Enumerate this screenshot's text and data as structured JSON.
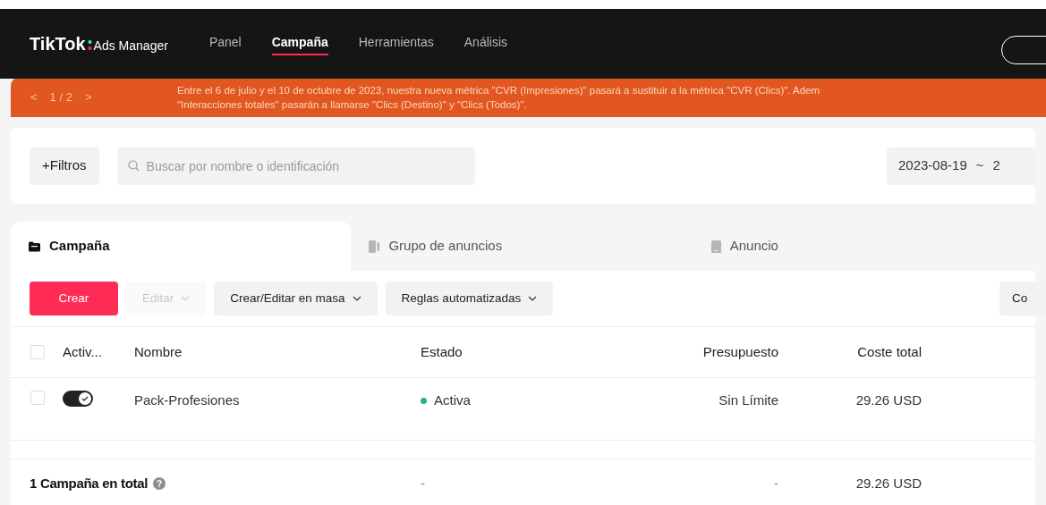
{
  "header": {
    "logo": "TikTok",
    "logo_sub": "Ads Manager",
    "nav": [
      {
        "label": "Panel",
        "selected": false
      },
      {
        "label": "Campaña",
        "selected": true
      },
      {
        "label": "Herramientas",
        "selected": false
      },
      {
        "label": "Análisis",
        "selected": false
      }
    ]
  },
  "banner": {
    "pager": "1 / 2",
    "prev": "<",
    "next": ">",
    "lines": [
      "Entre el 6 de julio y el 10 de octubre de 2023, nuestra nueva métrica \"CVR (Impresiones)\" pasará a sustituir a la métrica \"CVR (Clics)\". Adem",
      "\"Interacciones totales\" pasarán a llamarse \"Clics (Destino)\" y \"Clics (Todos)\"."
    ]
  },
  "filters": {
    "button": "+Filtros",
    "search": {
      "placeholder": "Buscar por nombre o identificación"
    },
    "date_from": "2023-08-19",
    "date_sep": "~",
    "date_to": "2"
  },
  "tabs": [
    {
      "label": "Campaña",
      "selected": true
    },
    {
      "label": "Grupo de anuncios",
      "selected": false
    },
    {
      "label": "Anuncio",
      "selected": false
    }
  ],
  "toolbar": [
    {
      "label": "Crear",
      "kind": "primary",
      "disabled": false
    },
    {
      "label": "Editar",
      "kind": "dropdown",
      "disabled": true
    },
    {
      "label": "Crear/Editar en masa",
      "kind": "dropdown",
      "disabled": false
    },
    {
      "label": "Reglas automatizadas",
      "kind": "dropdown",
      "disabled": false
    }
  ],
  "toolbar_right": "Co",
  "table": {
    "columns": [
      "Activ...",
      "Nombre",
      "Estado",
      "Presupuesto",
      "Coste total"
    ],
    "rows": [
      {
        "checked": false,
        "on": true,
        "name": "Pack-Profesiones",
        "status": "Activa",
        "color": "#22b573",
        "budget": "Sin Límite",
        "cost": "29.26 USD"
      }
    ],
    "select_all_checked": false,
    "total": {
      "label": "1 Campaña en total",
      "help": "?",
      "status": "-",
      "budget": "-",
      "cost": "29.26 USD"
    }
  }
}
